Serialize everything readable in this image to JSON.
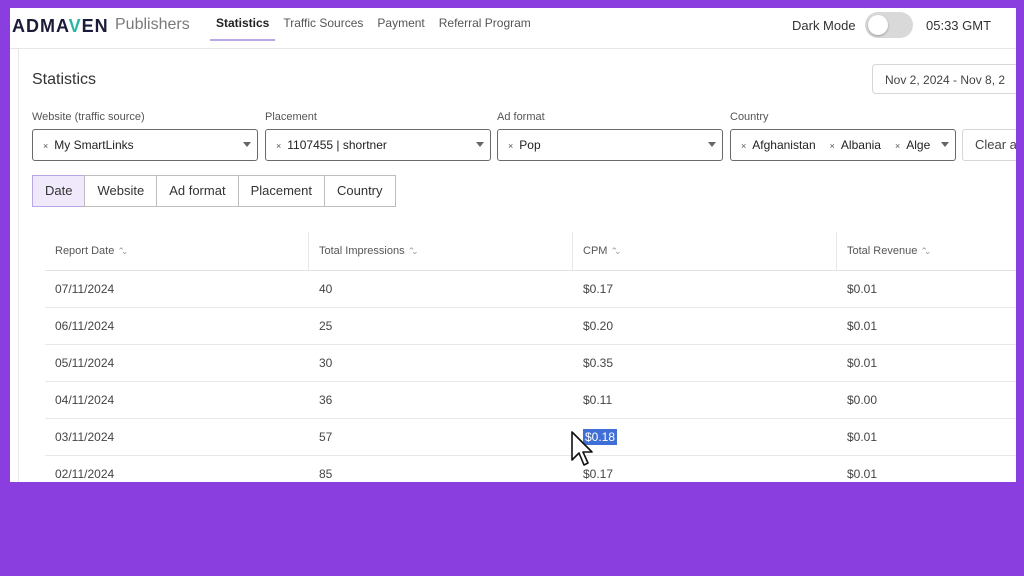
{
  "brand": {
    "logo_prefix": "ADMA",
    "logo_v": "V",
    "logo_suffix": "EN",
    "subtitle": "Publishers"
  },
  "nav": {
    "items": [
      {
        "label": "Statistics",
        "active": true
      },
      {
        "label": "Traffic Sources",
        "active": false
      },
      {
        "label": "Payment",
        "active": false
      },
      {
        "label": "Referral Program",
        "active": false
      }
    ]
  },
  "header": {
    "dark_mode_label": "Dark Mode",
    "dark_mode_on": false,
    "time": "05:33 GMT"
  },
  "page": {
    "title": "Statistics",
    "date_range": "Nov 2, 2024 - Nov 8, 2"
  },
  "filters": {
    "website": {
      "label": "Website (traffic source)",
      "chips": [
        "My SmartLinks"
      ]
    },
    "placement": {
      "label": "Placement",
      "chips": [
        "1107455 | shortner"
      ]
    },
    "ad_format": {
      "label": "Ad format",
      "chips": [
        "Pop"
      ]
    },
    "country": {
      "label": "Country",
      "chips": [
        "Afghanistan",
        "Albania",
        "Alge"
      ]
    },
    "clear_label": "Clear a"
  },
  "group_tabs": [
    "Date",
    "Website",
    "Ad format",
    "Placement",
    "Country"
  ],
  "table": {
    "columns": [
      "Report Date",
      "Total Impressions",
      "CPM",
      "Total Revenue"
    ],
    "rows": [
      [
        "07/11/2024",
        "40",
        "$0.17",
        "$0.01"
      ],
      [
        "06/11/2024",
        "25",
        "$0.20",
        "$0.01"
      ],
      [
        "05/11/2024",
        "30",
        "$0.35",
        "$0.01"
      ],
      [
        "04/11/2024",
        "36",
        "$0.11",
        "$0.00"
      ],
      [
        "03/11/2024",
        "57",
        "$0.18",
        "$0.01"
      ],
      [
        "02/11/2024",
        "85",
        "$0.17",
        "$0.01"
      ]
    ]
  },
  "colors": {
    "frame": "#8a3ee0",
    "accent": "#b8a6e6",
    "selection": "#3f6fd6"
  }
}
